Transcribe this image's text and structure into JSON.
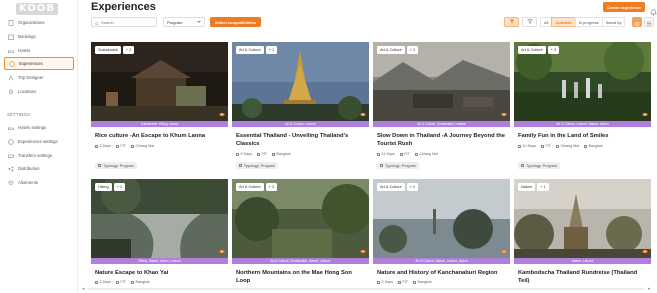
{
  "app": {
    "logo": "KOOB"
  },
  "sidebar": {
    "items": [
      {
        "label": "Organizations",
        "icon": "building-icon"
      },
      {
        "label": "Bookings",
        "icon": "calendar-icon"
      },
      {
        "label": "Hotels",
        "icon": "bed-icon"
      },
      {
        "label": "Experiences",
        "icon": "compass-icon"
      },
      {
        "label": "Trip Designer",
        "icon": "route-icon"
      },
      {
        "label": "Locations",
        "icon": "pin-icon"
      }
    ],
    "settings_label": "SETTINGS",
    "settings_items": [
      {
        "label": "Hotels settings",
        "icon": "bed-icon"
      },
      {
        "label": "Experiences settings",
        "icon": "compass-icon"
      },
      {
        "label": "Transfers settings",
        "icon": "car-icon"
      },
      {
        "label": "Distribution",
        "icon": "share-icon"
      },
      {
        "label": "Allotments",
        "icon": "stack-icon"
      }
    ]
  },
  "header": {
    "title": "Experiences",
    "create_button": "Create experience"
  },
  "toolbar": {
    "search_placeholder": "Search",
    "program_select": "Program",
    "compat_button": "Select compatibilities",
    "statuses": [
      "All",
      "Available",
      "In progress",
      "Stand by"
    ],
    "active_status": "Available"
  },
  "colors": {
    "accent": "#f07b22",
    "band": "#b07fde"
  },
  "cards": [
    {
      "tags": [
        "Sustainable",
        "+ 2"
      ],
      "band": "Sustainable, Hiking, Action",
      "title_l1": "Rice culture -An Escape to Khum Lanna",
      "title_l2": "",
      "days": "3 Days",
      "type": "FIT",
      "place": "Chiang Mai",
      "typology": "Typology: Program"
    },
    {
      "tags": [
        "Art & Culture",
        "+ 1"
      ],
      "band": "Art & Culture, Leisure",
      "title_l1": "Essential Thailand - Unveiling Thailand's",
      "title_l2": "Classics",
      "days": "9 Days",
      "type": "FIT",
      "place": "Bangkok",
      "typology": "Typology: Program"
    },
    {
      "tags": [
        "Art & Culture",
        "+ 2"
      ],
      "band": "Art & Culture, Sustainable, Leisure",
      "title_l1": "Slow Down in Thailand -A Journey Beyond the",
      "title_l2": "Tourist Rush",
      "days": "11 Days",
      "type": "FIT",
      "place": "Chiang Mai",
      "typology": "Typology: Program"
    },
    {
      "tags": [
        "Art & Culture",
        "+ 3"
      ],
      "band": "Art & Culture, Leisure, Nature, Action",
      "title_l1": "Family Fun in the Land of Smiles",
      "title_l2": "",
      "days": "10 Days",
      "type": "FIT",
      "place": "Chiang Mai",
      "place2": "Bangkok",
      "typology": "Typology: Program"
    },
    {
      "tags": [
        "Hiking",
        "+ 1"
      ],
      "band": "Hiking, Nature, Action, Leisure",
      "title_l1": "Nature Escape to Khao Yai",
      "title_l2": "",
      "days": "3 Days",
      "type": "FIT",
      "place": "Bangkok"
    },
    {
      "tags": [
        "Art & Culture",
        "+ 3"
      ],
      "band": "Art & Culture, Sustainable, Nature, Leisure",
      "title_l1": "Northern Mountains on the Mae Hong Son",
      "title_l2": "Loop",
      "days": "9 Days",
      "type": "FIT",
      "place": "Chiang Mai"
    },
    {
      "tags": [
        "Art & Culture",
        "+ 2"
      ],
      "band": "Art & Culture, Nature, Leisure, Action",
      "title_l1": "Nature and History of Kanchanaburi Region",
      "title_l2": "",
      "days": "3 Days",
      "type": "FIT",
      "place": "Bangkok"
    },
    {
      "tags": [
        "Nature",
        "+ 1"
      ],
      "band": "Nature, Leisure",
      "title_l1": "Kambodscha Thailand Rundreise (Thailand",
      "title_l2": "Teil)",
      "days": "",
      "type": "",
      "place": ""
    }
  ]
}
